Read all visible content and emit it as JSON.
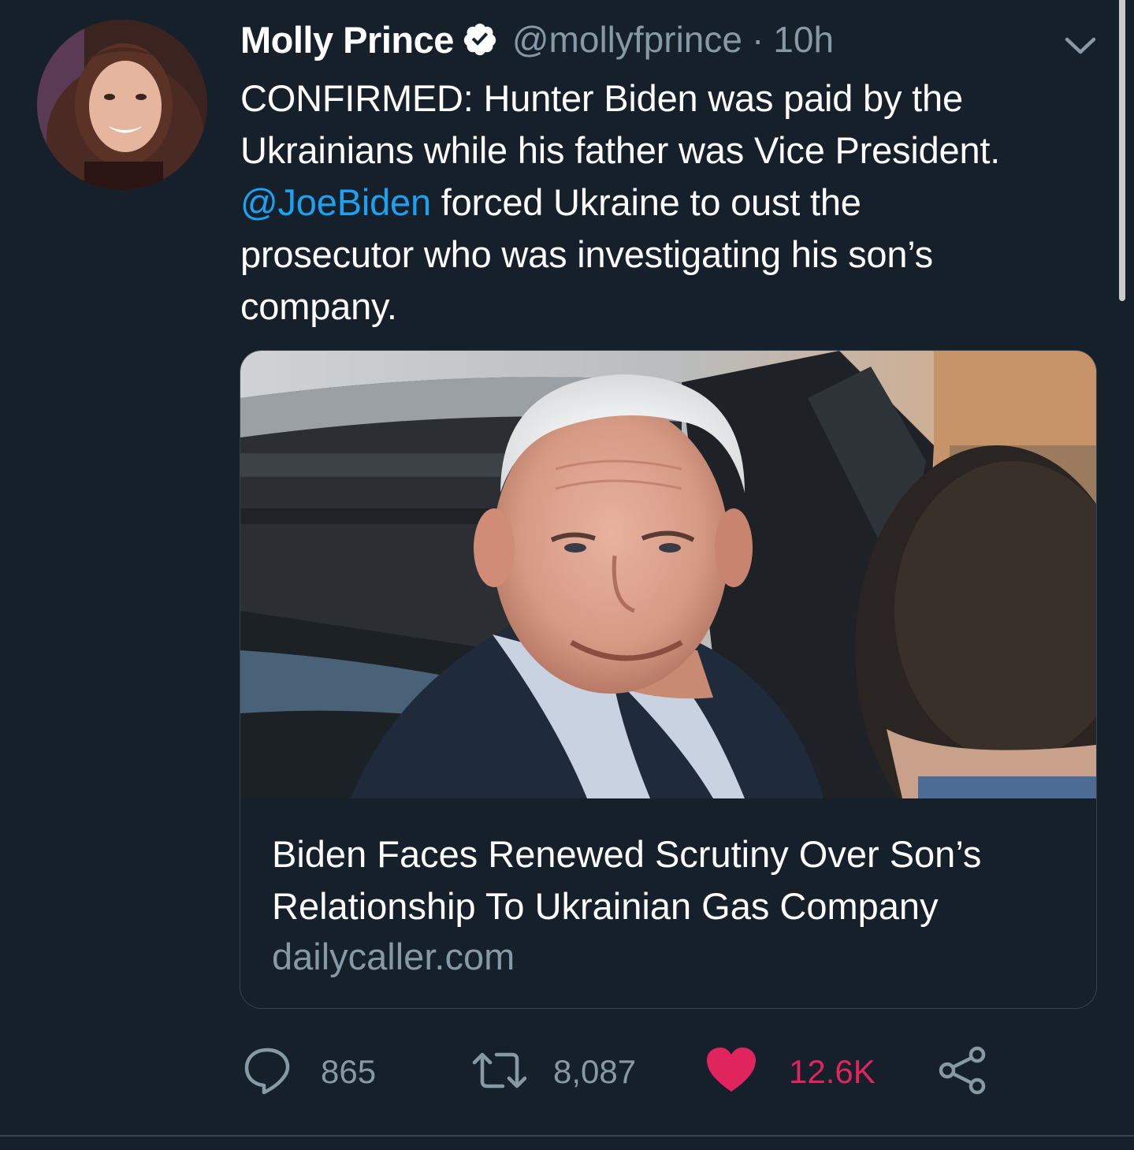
{
  "tweet": {
    "author_name": "Molly Prince",
    "verified_icon": "verified-badge-icon",
    "handle": "@mollyfprince",
    "separator": "·",
    "time": "10h",
    "text_line1": "CONFIRMED: Hunter Biden was paid by the",
    "text_line2": "Ukrainians while his father was Vice President.",
    "mention": "@JoeBiden",
    "text_line3_rest": " forced Ukraine to oust the",
    "text_line4": "prosecutor who was investigating his son’s",
    "text_line5": "company."
  },
  "card": {
    "title_line1": "Biden Faces Renewed Scrutiny Over Son’s",
    "title_line2": "Relationship To Ukrainian Gas Company",
    "domain": "dailycaller.com"
  },
  "actions": {
    "reply_count": "865",
    "retweet_count": "8,087",
    "like_count": "12.6K"
  },
  "colors": {
    "background": "#15202b",
    "link": "#1da1f2",
    "like": "#e0245e",
    "secondary_text": "#8899a6"
  }
}
